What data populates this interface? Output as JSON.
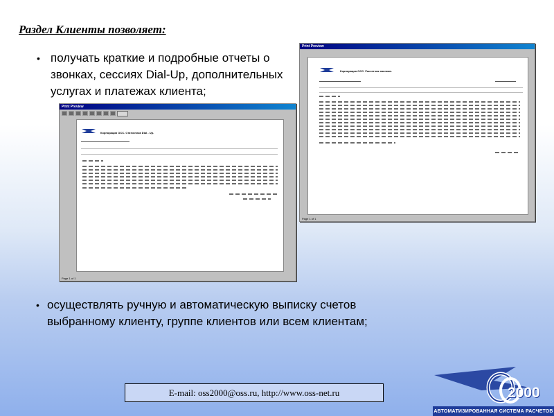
{
  "heading": "Раздел Клиенты позволяет:",
  "bullets": [
    "получать краткие и подробные отчеты о звонках, сессиях Dial-Up, дополнительных услугах и платежах клиента;",
    "осуществлять ручную и автоматическую выписку счетов выбранному клиенту, группе клиентов или всем клиентам;"
  ],
  "bullet_glyph": "•",
  "footer": "E-mail: oss2000@oss.ru,  http://www.oss-net.ru",
  "brand": {
    "year": "2000",
    "banner": "АВТОМАТИЗИРОВАННАЯ СИСТЕМА РАСЧЕТОВ"
  },
  "screens": [
    {
      "title": "Print Preview",
      "header": "Корпорация ОСС. Статистика Dial - Up.",
      "status": "Page 1 of 1"
    },
    {
      "title": "Print Preview",
      "header": "Корпорация ОСС. Расчетчик звонков.",
      "status": "Page 1 of 1"
    }
  ],
  "colors": {
    "title_bar": "#000080",
    "brand_blue": "#1f3d9a"
  }
}
